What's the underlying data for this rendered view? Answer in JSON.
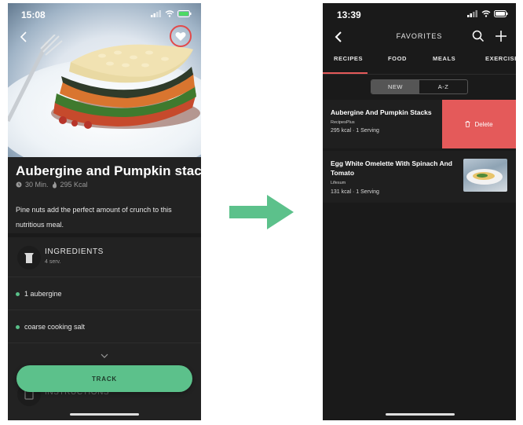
{
  "left": {
    "status": {
      "time": "15:08"
    },
    "recipe": {
      "title": "Aubergine and Pumpkin stacks",
      "time": "30 Min.",
      "kcal": "295 Kcal",
      "description": "Pine nuts add the perfect amount of crunch to this nutritious meal."
    },
    "ingredients": {
      "title": "INGREDIENTS",
      "servings": "4 serv.",
      "items": [
        "1 aubergine",
        "coarse cooking salt"
      ]
    },
    "instructions": {
      "title": "INSTRUCTIONS"
    },
    "track_label": "TRACK"
  },
  "right": {
    "status": {
      "time": "13:39"
    },
    "nav_title": "FAVORITES",
    "tabs": [
      "RECIPES",
      "FOOD",
      "MEALS",
      "EXERCISES"
    ],
    "segments": [
      "NEW",
      "A-Z"
    ],
    "items": [
      {
        "title": "Aubergine And Pumpkin Stacks",
        "source": "RecipesPlus",
        "kcal": "295 kcal · 1 Serving"
      },
      {
        "title": "Egg White Omelette With Spinach And Tomato",
        "source": "Lifesum",
        "kcal": "131 kcal · 1 Serving"
      }
    ],
    "delete_label": "Delete"
  },
  "colors": {
    "accent_green": "#5cc18b",
    "accent_red": "#e45a5a",
    "background": "#1a1a1a"
  }
}
